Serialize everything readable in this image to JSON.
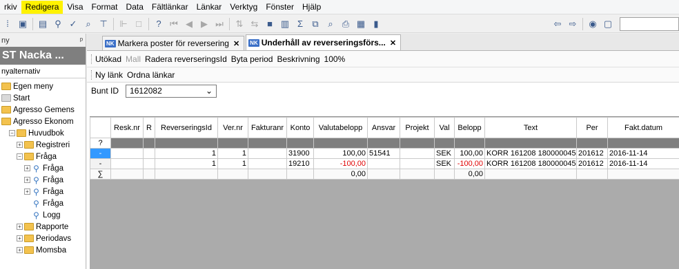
{
  "menu": [
    "rkiv",
    "Redigera",
    "Visa",
    "Format",
    "Data",
    "Fältlänkar",
    "Länkar",
    "Verktyg",
    "Fönster",
    "Hjälp"
  ],
  "menu_active_index": 1,
  "colors": {
    "menu_highlight": "#fff200",
    "selected_row_header": "#3399ff",
    "negative_text": "#e00000",
    "sidebar_title_bg": "#7f7f7f"
  },
  "sidebar": {
    "header": "ny",
    "pin": "ᵖ",
    "title": "ST Nacka ...",
    "subtitle": "nyalternativ",
    "items": [
      {
        "label": "Egen meny",
        "icon": "folder-icon",
        "indent": 0
      },
      {
        "label": "Start",
        "icon": "folder-gray-icon",
        "indent": 0
      },
      {
        "label": "Agresso Gemens",
        "icon": "folder-icon",
        "indent": 0
      },
      {
        "label": "Agresso Ekonom",
        "icon": "folder-open-icon",
        "indent": 0
      },
      {
        "label": "Huvudbok",
        "icon": "folder-open-icon",
        "indent": 1,
        "expander": "−"
      },
      {
        "label": "Registreri",
        "icon": "folder-icon",
        "indent": 2,
        "expander": "+"
      },
      {
        "label": "Fråga",
        "icon": "folder-open-icon",
        "indent": 2,
        "expander": "−"
      },
      {
        "label": "Fråga",
        "icon": "query-icon",
        "indent": 3,
        "expander": "+"
      },
      {
        "label": "Fråga",
        "icon": "query-icon",
        "indent": 3,
        "expander": "+"
      },
      {
        "label": "Fråga",
        "icon": "query-icon",
        "indent": 3,
        "expander": "+"
      },
      {
        "label": "Fråga",
        "icon": "query-icon",
        "indent": 4
      },
      {
        "label": "Logg",
        "icon": "query-icon",
        "indent": 4
      },
      {
        "label": "Rapporte",
        "icon": "folder-icon",
        "indent": 2,
        "expander": "+"
      },
      {
        "label": "Periodavs",
        "icon": "folder-icon",
        "indent": 2,
        "expander": "+"
      },
      {
        "label": "Momsba",
        "icon": "folder-icon",
        "indent": 2,
        "expander": "+"
      }
    ]
  },
  "tabs": [
    {
      "badge": "NK",
      "label": "Markera poster för reversering",
      "close": "✕",
      "active": false
    },
    {
      "badge": "NK",
      "label": "Underhåll av reverseringsförs...",
      "close": "✕",
      "active": true
    }
  ],
  "actions1": [
    {
      "label": "Utökad",
      "enabled": true
    },
    {
      "label": "Mall",
      "enabled": false
    },
    {
      "label": "Radera reverseringsId",
      "enabled": true
    },
    {
      "label": "Byta period",
      "enabled": true
    },
    {
      "label": "Beskrivning",
      "enabled": true
    },
    {
      "label": "100%",
      "enabled": true
    }
  ],
  "actions2": [
    {
      "label": "Ny länk",
      "enabled": true
    },
    {
      "label": "Ordna länkar",
      "enabled": true
    }
  ],
  "filter": {
    "label": "Bunt ID",
    "value": "1612082",
    "arrow": "⌄"
  },
  "grid": {
    "columns": [
      "",
      "Resk.nr",
      "R",
      "ReverseringsId",
      "Ver.nr",
      "Fakturanr",
      "Konto",
      "Valutabelopp",
      "Ansvar",
      "Projekt",
      "Val",
      "Belopp",
      "Text",
      "Per",
      "Fakt.datum"
    ],
    "new_row_marker": "?",
    "rows": [
      {
        "marker": "-",
        "resk": "",
        "r": "",
        "revid": "1",
        "vernr": "1",
        "faktnr": "",
        "konto": "31900",
        "valuta": "100,00",
        "ansvar": "51541",
        "projekt": "",
        "val": "SEK",
        "belopp": "100,00",
        "text": "KORR 161208 180000045",
        "per": "201612",
        "faktdatum": "2016-11-14",
        "negative": false
      },
      {
        "marker": "-",
        "resk": "",
        "r": "",
        "revid": "1",
        "vernr": "1",
        "faktnr": "",
        "konto": "19210",
        "valuta": "-100,00",
        "ansvar": "",
        "projekt": "",
        "val": "SEK",
        "belopp": "-100,00",
        "text": "KORR 161208 180000045",
        "per": "201612",
        "faktdatum": "2016-11-14",
        "negative": true
      }
    ],
    "sum": {
      "marker": "∑",
      "valuta": "0,00",
      "belopp": "0,00"
    }
  }
}
